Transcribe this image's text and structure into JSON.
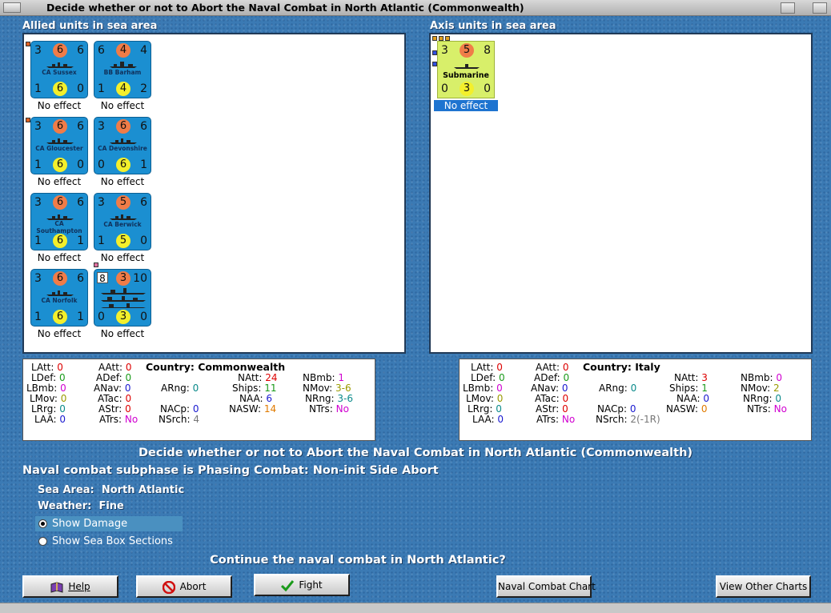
{
  "window": {
    "title": "Decide whether or not to Abort the Naval Combat in North Atlantic (Commonwealth)"
  },
  "allied": {
    "header": "Allied units in sea area",
    "units": [
      {
        "name": "CA Sussex",
        "tl": "3",
        "tc": "6",
        "tr": "6",
        "bl": "1",
        "bc": "6",
        "br": "0",
        "effect": "No effect"
      },
      {
        "name": "BB Barham",
        "tl": "6",
        "tc": "4",
        "tr": "4",
        "bl": "1",
        "bc": "4",
        "br": "2",
        "effect": "No effect"
      },
      {
        "name": "CA Gloucester",
        "tl": "3",
        "tc": "6",
        "tr": "6",
        "bl": "1",
        "bc": "6",
        "br": "0",
        "effect": "No effect"
      },
      {
        "name": "CA Devonshire",
        "tl": "3",
        "tc": "6",
        "tr": "6",
        "bl": "0",
        "bc": "6",
        "br": "1",
        "effect": "No effect"
      },
      {
        "name": "CA Southampton",
        "tl": "3",
        "tc": "6",
        "tr": "6",
        "bl": "1",
        "bc": "6",
        "br": "1",
        "effect": "No effect"
      },
      {
        "name": "CA Berwick",
        "tl": "3",
        "tc": "5",
        "tr": "6",
        "bl": "1",
        "bc": "5",
        "br": "0",
        "effect": "No effect"
      },
      {
        "name": "CA Norfolk",
        "tl": "3",
        "tc": "6",
        "tr": "6",
        "bl": "1",
        "bc": "6",
        "br": "1",
        "effect": "No effect"
      },
      {
        "name": "",
        "tl": "8",
        "tc": "3",
        "tr": "10",
        "bl": "0",
        "bc": "3",
        "br": "0",
        "effect": "No effect"
      }
    ]
  },
  "axis": {
    "header": "Axis units in sea area",
    "units": [
      {
        "name": "Submarine",
        "tl": "3",
        "tc": "5",
        "tr": "8",
        "bl": "0",
        "bc": "3",
        "br": "0",
        "effect": "No effect"
      }
    ]
  },
  "allied_stats": {
    "country_label": "Country:",
    "country": "Commonwealth",
    "LAtt": "0",
    "LDef": "0",
    "LBmb": "0",
    "LMov": "0",
    "LRrg": "0",
    "LAA": "0",
    "AAtt": "0",
    "ADef": "0",
    "ANav": "0",
    "ATac": "0",
    "AStr": "0",
    "ATrs": "No",
    "ARng": "0",
    "NACp": "0",
    "NSrch": "4",
    "NAtt": "24",
    "Ships": "11",
    "NAA": "6",
    "NASW": "14",
    "NBmb": "1",
    "NMov": "3-6",
    "NRng": "3-6",
    "NTrs": "No"
  },
  "axis_stats": {
    "country_label": "Country:",
    "country": "Italy",
    "LAtt": "0",
    "LDef": "0",
    "LBmb": "0",
    "LMov": "0",
    "LRrg": "0",
    "LAA": "0",
    "AAtt": "0",
    "ADef": "0",
    "ANav": "0",
    "ATac": "0",
    "AStr": "0",
    "ATrs": "No",
    "ARng": "0",
    "NACp": "0",
    "NSrch": "2(-1R)",
    "NAtt": "3",
    "Ships": "1",
    "NAA": "0",
    "NASW": "0",
    "NBmb": "0",
    "NMov": "2",
    "NRng": "0",
    "NTrs": "No"
  },
  "labels": {
    "LAtt": "LAtt:",
    "LDef": "LDef:",
    "LBmb": "LBmb:",
    "LMov": "LMov:",
    "LRrg": "LRrg:",
    "LAA": "LAA:",
    "AAtt": "AAtt:",
    "ADef": "ADef:",
    "ANav": "ANav:",
    "ATac": "ATac:",
    "AStr": "AStr:",
    "ATrs": "ATrs:",
    "ARng": "ARng:",
    "NACp": "NACp:",
    "NSrch": "NSrch:",
    "NAtt": "NAtt:",
    "Ships": "Ships:",
    "NAA": "NAA:",
    "NASW": "NASW:",
    "NBmb": "NBmb:",
    "NMov": "NMov:",
    "NRng": "NRng:",
    "NTrs": "NTrs:"
  },
  "messages": {
    "heading": "Decide whether or not to Abort the Naval Combat in North Atlantic (Commonwealth)",
    "subphase": "Naval combat subphase is Phasing Combat: Non-init Side Abort",
    "sea_area_label": "Sea Area:",
    "sea_area": "North Atlantic",
    "weather_label": "Weather:",
    "weather": "Fine",
    "question": "Continue the naval combat in North Atlantic?"
  },
  "options": {
    "show_damage": "Show Damage",
    "show_sea_box": "Show Sea Box Sections",
    "selected": "Show Damage"
  },
  "buttons": {
    "help": "Help",
    "abort": "Abort",
    "fight": "Fight",
    "naval_chart": "Naval Combat Chart",
    "view_charts": "View Other Charts"
  },
  "colors": {
    "background": "#3b7ab4",
    "counter_allied": "#1b8fd1",
    "counter_axis": "#d8ef6a",
    "attack_circle": "#f07c48",
    "defense_circle": "#f3ef2c"
  }
}
